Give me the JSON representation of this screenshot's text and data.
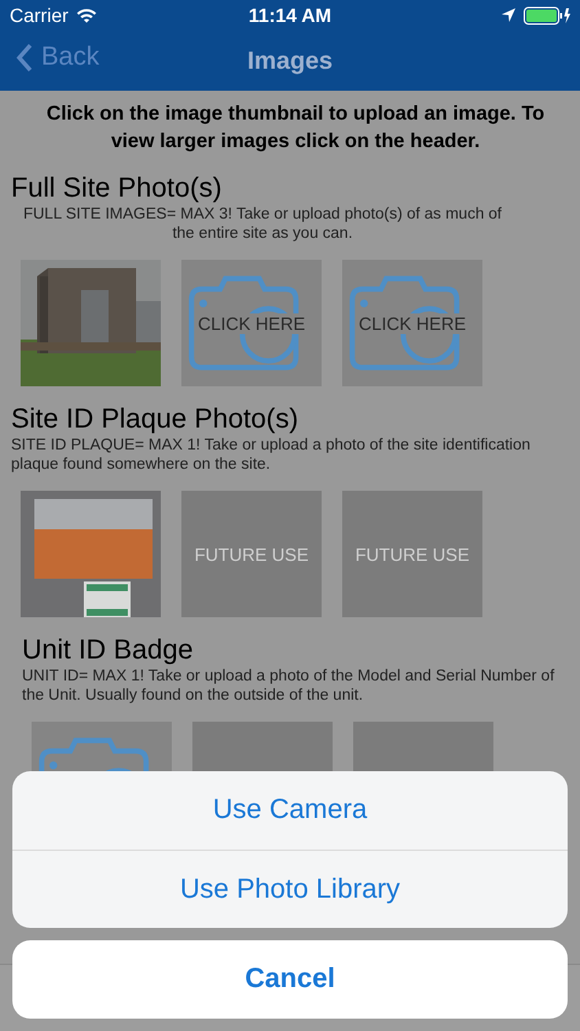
{
  "status_bar": {
    "carrier": "Carrier",
    "time": "11:14 AM"
  },
  "nav": {
    "back": "Back",
    "title": "Images"
  },
  "instructions": "Click on the image thumbnail to upload an image.    To view larger images click on the header.",
  "sections": [
    {
      "title": "Full Site Photo(s)",
      "note": "FULL SITE IMAGES= MAX 3!  Take or upload photo(s) of as much of the entire site as you can.",
      "thumbs": [
        {
          "kind": "picture"
        },
        {
          "kind": "camera",
          "label": "CLICK HERE"
        },
        {
          "kind": "camera",
          "label": "CLICK HERE"
        }
      ]
    },
    {
      "title": "Site ID Plaque Photo(s)",
      "note": "SITE ID PLAQUE= MAX 1!  Take or upload a photo of the site identification plaque found somewhere on the site.",
      "thumbs": [
        {
          "kind": "picture"
        },
        {
          "kind": "blank",
          "label": "FUTURE USE"
        },
        {
          "kind": "blank",
          "label": "FUTURE USE"
        }
      ]
    },
    {
      "title": "Unit ID Badge",
      "note": "UNIT ID= MAX 1!  Take or upload a photo of the Model and Serial Number of the Unit.  Usually found on the outside of the unit.",
      "thumbs": [
        {
          "kind": "camera"
        },
        {
          "kind": "blank"
        },
        {
          "kind": "blank"
        }
      ]
    }
  ],
  "action_sheet": {
    "actions": [
      "Use Camera",
      "Use Photo Library"
    ],
    "cancel": "Cancel"
  }
}
